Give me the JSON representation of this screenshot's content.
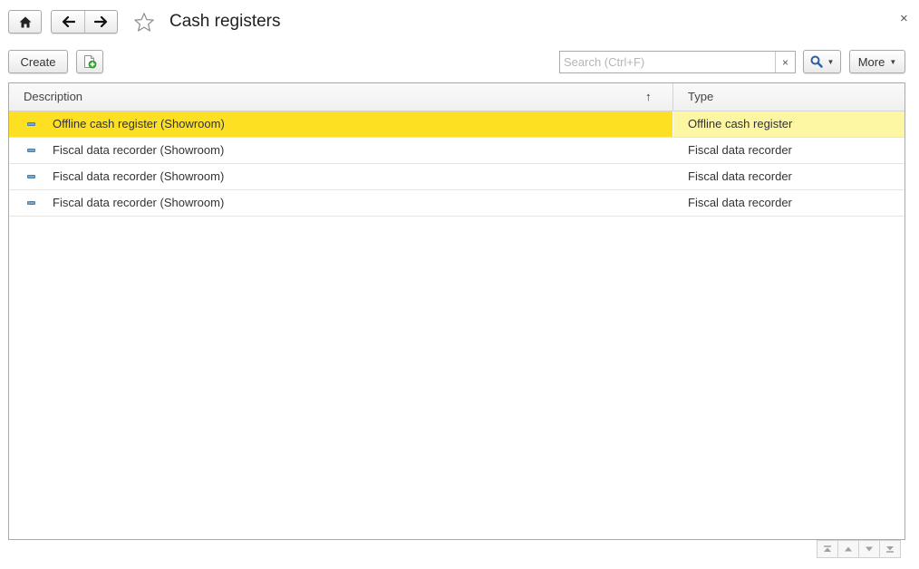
{
  "header": {
    "title": "Cash registers",
    "home_icon": "home-icon",
    "back_icon": "arrow-left-icon",
    "forward_icon": "arrow-right-icon",
    "favorite_icon": "star-outline-icon",
    "close_label": "×"
  },
  "toolbar": {
    "create_label": "Create",
    "copy_icon": "add-copy-icon",
    "search_placeholder": "Search (Ctrl+F)",
    "search_value": "",
    "search_clear_label": "×",
    "search_icon": "magnifier-icon",
    "more_label": "More"
  },
  "table": {
    "columns": [
      {
        "label": "Description",
        "sort": "ascending",
        "sort_indicator": "↑"
      },
      {
        "label": "Type"
      }
    ],
    "rows": [
      {
        "description": "Offline cash register (Showroom)",
        "type": "Offline cash register",
        "selected": true
      },
      {
        "description": "Fiscal data recorder (Showroom)",
        "type": "Fiscal data recorder",
        "selected": false
      },
      {
        "description": "Fiscal data recorder (Showroom)",
        "type": "Fiscal data recorder",
        "selected": false
      },
      {
        "description": "Fiscal data recorder (Showroom)",
        "type": "Fiscal data recorder",
        "selected": false
      }
    ]
  },
  "scroll_nav": [
    {
      "name": "scroll-first-icon"
    },
    {
      "name": "scroll-up-icon"
    },
    {
      "name": "scroll-down-icon"
    },
    {
      "name": "scroll-last-icon"
    }
  ],
  "colors": {
    "selected_row": "#fde021",
    "selected_row_secondary": "#fdf6a2",
    "border": "#a9a9a9",
    "icon_blue": "#2c5f9e"
  }
}
